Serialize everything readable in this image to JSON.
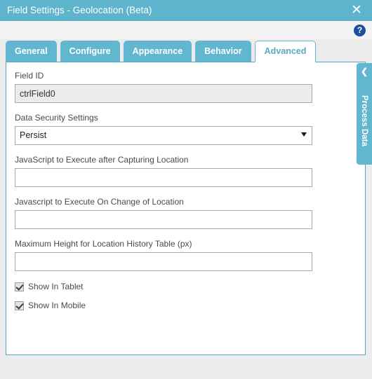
{
  "window": {
    "title": "Field Settings - Geolocation (Beta)",
    "close_label": "✕",
    "help_label": "?",
    "accent_color": "#5eb3cd",
    "help_color": "#1f4e9c"
  },
  "tabs": [
    {
      "label": "General",
      "active": false
    },
    {
      "label": "Configure",
      "active": false
    },
    {
      "label": "Appearance",
      "active": false
    },
    {
      "label": "Behavior",
      "active": false
    },
    {
      "label": "Advanced",
      "active": true
    }
  ],
  "side_panel": {
    "label": "Process Data",
    "chevron": "❮"
  },
  "form": {
    "field_id": {
      "label": "Field ID",
      "value": "ctrlField0",
      "placeholder": ""
    },
    "data_security": {
      "label": "Data Security Settings",
      "value": "Persist",
      "options": [
        "Persist"
      ]
    },
    "js_after_capture": {
      "label": "JavaScript to Execute after Capturing Location",
      "value": "",
      "placeholder": ""
    },
    "js_on_change": {
      "label": "Javascript to Execute On Change of Location",
      "value": "",
      "placeholder": ""
    },
    "max_height": {
      "label": "Maximum Height for Location History Table (px)",
      "value": "",
      "placeholder": ""
    },
    "show_in_tablet": {
      "label": "Show In Tablet",
      "checked": true
    },
    "show_in_mobile": {
      "label": "Show In Mobile",
      "checked": true
    }
  }
}
